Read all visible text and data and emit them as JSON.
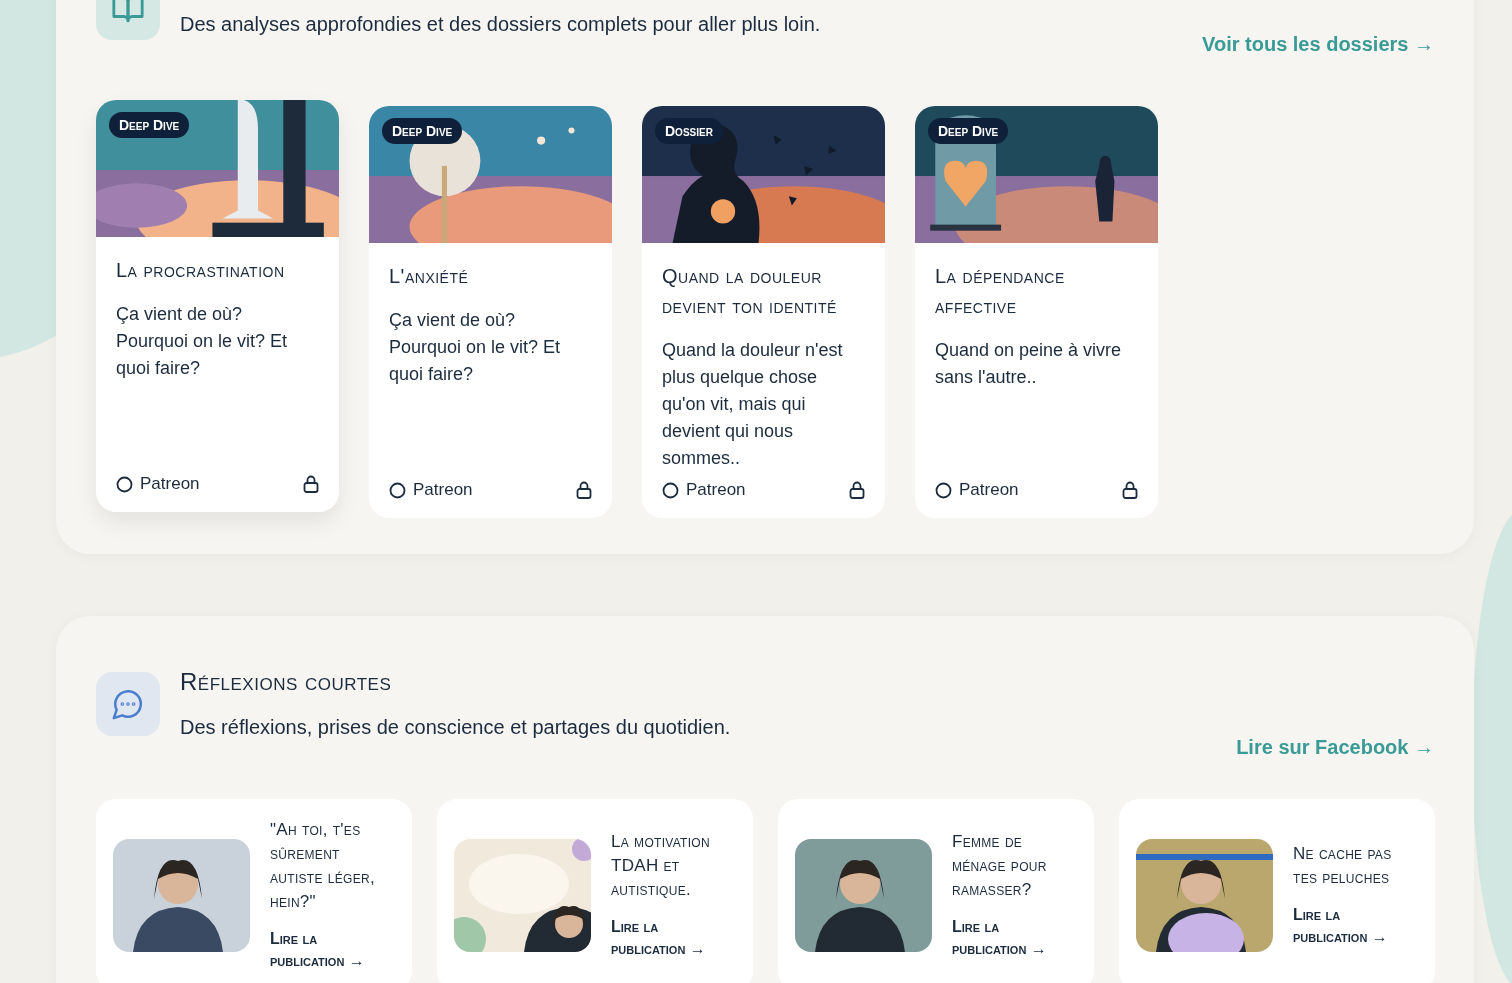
{
  "dossiers": {
    "description": "Des analyses approfondies et des dossiers complets pour aller plus loin.",
    "link": "Voir tous les dossiers →",
    "cards": [
      {
        "tag": "Deep Dive",
        "title": "La procrastination",
        "text": "Ça vient de où? Pourquoi on le vit? Et quoi faire?",
        "platform": "Patreon",
        "locked": true,
        "raised": true
      },
      {
        "tag": "Deep Dive",
        "title": "L'anxiété",
        "text": "Ça vient de où? Pourquoi on le vit? Et quoi faire?",
        "platform": "Patreon",
        "locked": true,
        "raised": false
      },
      {
        "tag": "Dossier",
        "title": "Quand la douleur devient ton identité",
        "text": "Quand la douleur n'est plus quelque chose qu'on vit, mais qui devient qui nous sommes..",
        "platform": "Patreon",
        "locked": true,
        "raised": false
      },
      {
        "tag": "Deep Dive",
        "title": "La dépendance affective",
        "text": "Quand on peine à vivre sans l'autre..",
        "platform": "Patreon",
        "locked": true,
        "raised": false
      }
    ]
  },
  "reflexions": {
    "title": "Réflexions courtes",
    "description": "Des réflexions, prises de conscience et partages du quotidien.",
    "link": "Lire sur Facebook →",
    "posts": [
      {
        "title": "\"Ah toi, t'es sûrement autiste léger, hein?\"",
        "link": "Lire la publication →"
      },
      {
        "title": "La motivation TDAH et autistique.",
        "link": "Lire la publication →"
      },
      {
        "title": "Femme de ménage pour ramasser?",
        "link": "Lire la publication →"
      },
      {
        "title": "Ne cache pas tes peluches",
        "link": "Lire la publication →"
      }
    ]
  }
}
